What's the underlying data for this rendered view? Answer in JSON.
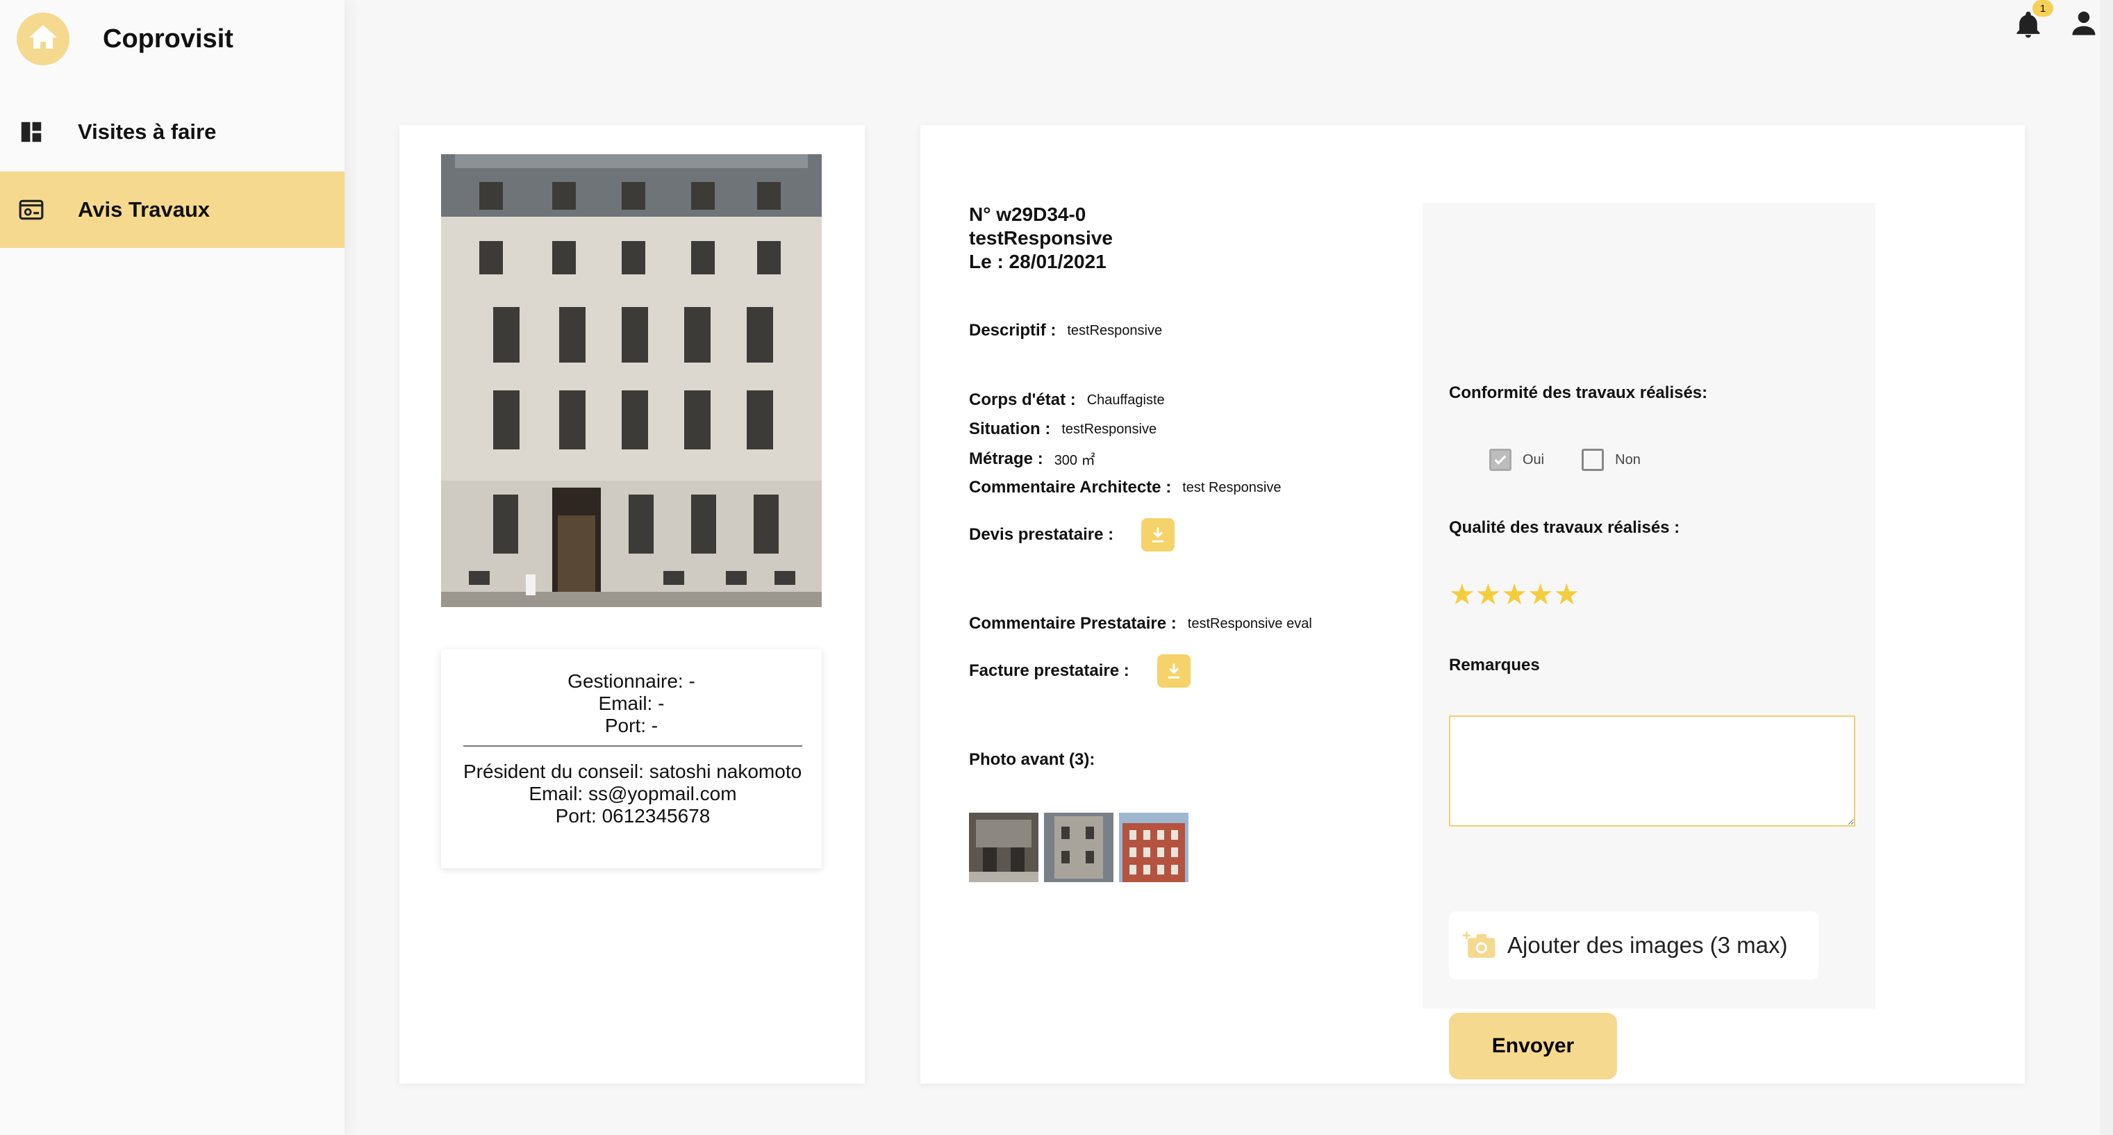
{
  "sidebar": {
    "brand": "Coprovisit",
    "items": [
      {
        "label": "Visites à faire",
        "icon": "dashboard-icon"
      },
      {
        "label": "Avis Travaux",
        "icon": "work-review-icon"
      }
    ]
  },
  "topbar": {
    "notification_count": "1"
  },
  "contact": {
    "gestionnaire": "Gestionnaire: -",
    "email": "Email: -",
    "port": "Port: -",
    "president": "Président du conseil: satoshi nakomoto",
    "president_email": "Email: ss@yopmail.com",
    "president_port": "Port: 0612345678"
  },
  "details": {
    "number": "N° w29D34-0",
    "name": "testResponsive",
    "date": "Le :  28/01/2021",
    "descriptif_label": "Descriptif :",
    "descriptif_value": "testResponsive",
    "corps_label": "Corps d'état :",
    "corps_value": "Chauffagiste",
    "situation_label": "Situation :",
    "situation_value": "testResponsive",
    "metrage_label": "Métrage :",
    "metrage_value": "300 ㎡",
    "comment_arch_label": "Commentaire Architecte :",
    "comment_arch_value": "test Responsive",
    "devis_label": "Devis prestataire :",
    "comment_presta_label": "Commentaire Prestataire :",
    "comment_presta_value": "testResponsive eval",
    "facture_label": "Facture prestataire :",
    "photos_label": "Photo avant (3):"
  },
  "evaluation": {
    "conformity_label": "Conformité des travaux réalisés:",
    "yes_label": "Oui",
    "no_label": "Non",
    "yes_checked": true,
    "no_checked": false,
    "quality_label": "Qualité des travaux réalisés :",
    "rating": 5,
    "rating_max": 5,
    "remarks_label": "Remarques",
    "remarks_value": "",
    "add_images_label": "Ajouter des images (3 max)",
    "send_label": "Envoyer"
  },
  "colors": {
    "accent": "#f5d98f",
    "star": "#f5cd3c",
    "download": "#f5d36a"
  }
}
